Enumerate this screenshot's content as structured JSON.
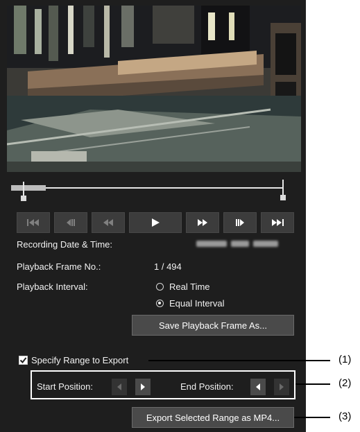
{
  "video": {
    "description_icon": "video-preview"
  },
  "transport": {
    "buttons": [
      {
        "icon": "skip-to-start-icon"
      },
      {
        "icon": "step-back-icon"
      },
      {
        "icon": "rewind-icon"
      },
      {
        "icon": "play-icon"
      },
      {
        "icon": "fast-forward-icon"
      },
      {
        "icon": "step-forward-icon"
      },
      {
        "icon": "skip-to-end-icon"
      }
    ]
  },
  "info": {
    "recording_label": "Recording Date & Time:",
    "frame_label": "Playback Frame No.:",
    "frame_value": "1 / 494",
    "interval_label": "Playback Interval:",
    "interval_options": [
      "Real Time",
      "Equal Interval"
    ],
    "interval_selected": "Equal Interval"
  },
  "buttons": {
    "save_frame": "Save Playback Frame As...",
    "export": "Export Selected Range as MP4..."
  },
  "export": {
    "specify_label": "Specify Range to Export",
    "specify_checked": true,
    "start_label": "Start Position:",
    "end_label": "End Position:"
  },
  "callouts": [
    "(1)",
    "(2)",
    "(3)"
  ],
  "colors": {
    "panel_bg": "#1e1e1e",
    "button_bg": "#4a4a4a",
    "text": "#ffffff"
  }
}
